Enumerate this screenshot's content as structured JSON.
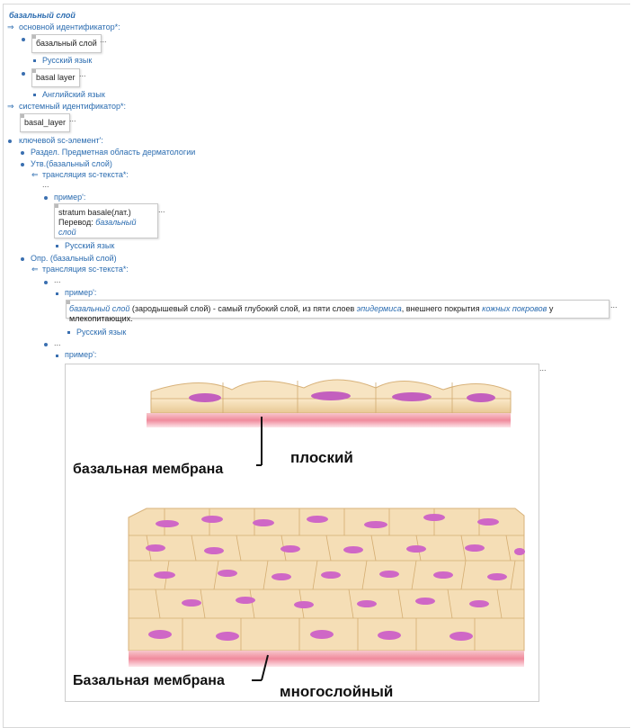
{
  "title": "базальный слой",
  "main_identifier_label": "основной идентификатор*:",
  "identifiers": [
    {
      "value": "базальный слой",
      "lang": "Русский язык"
    },
    {
      "value": "basal layer",
      "lang": "Английский язык"
    }
  ],
  "system_identifier_label": "системный идентификатор*:",
  "system_identifier_value": "basal_layer",
  "key_element_label": "ключевой sc-элемент':",
  "section_item": "Раздел. Предметная область дерматологии",
  "statement_item": "Утв.(базальный слой)",
  "translation_label": "трансляция sc-текста*:",
  "ellipsis": "...",
  "example_label": "пример':",
  "statement_text_line1": "stratum basale(лат.)",
  "statement_text_prefix": "Перевод: ",
  "statement_text_link": "базальный слой",
  "lang_ru": "Русский язык",
  "definition_item": "Опр. (базальный слой)",
  "definition": {
    "link1": "базальный слой",
    "t1": " (зародышевый слой) - самый глубокий слой, из пяти слоев ",
    "link2": "эпидермиса",
    "t2": ", внешнего покрытия ",
    "link3": "кожных покровов",
    "t3": " у млекопитающих."
  },
  "image": {
    "label_basal_top": "базальная мембрана",
    "label_flat": "плоский",
    "label_basal_bottom": "Базальная мембрана",
    "label_multi": "многослойный"
  },
  "colors": {
    "link": "#2b6cb0",
    "cell": "#f2d6a8",
    "nucleus": "#cc66c4",
    "membrane": "#f4a9b4"
  }
}
